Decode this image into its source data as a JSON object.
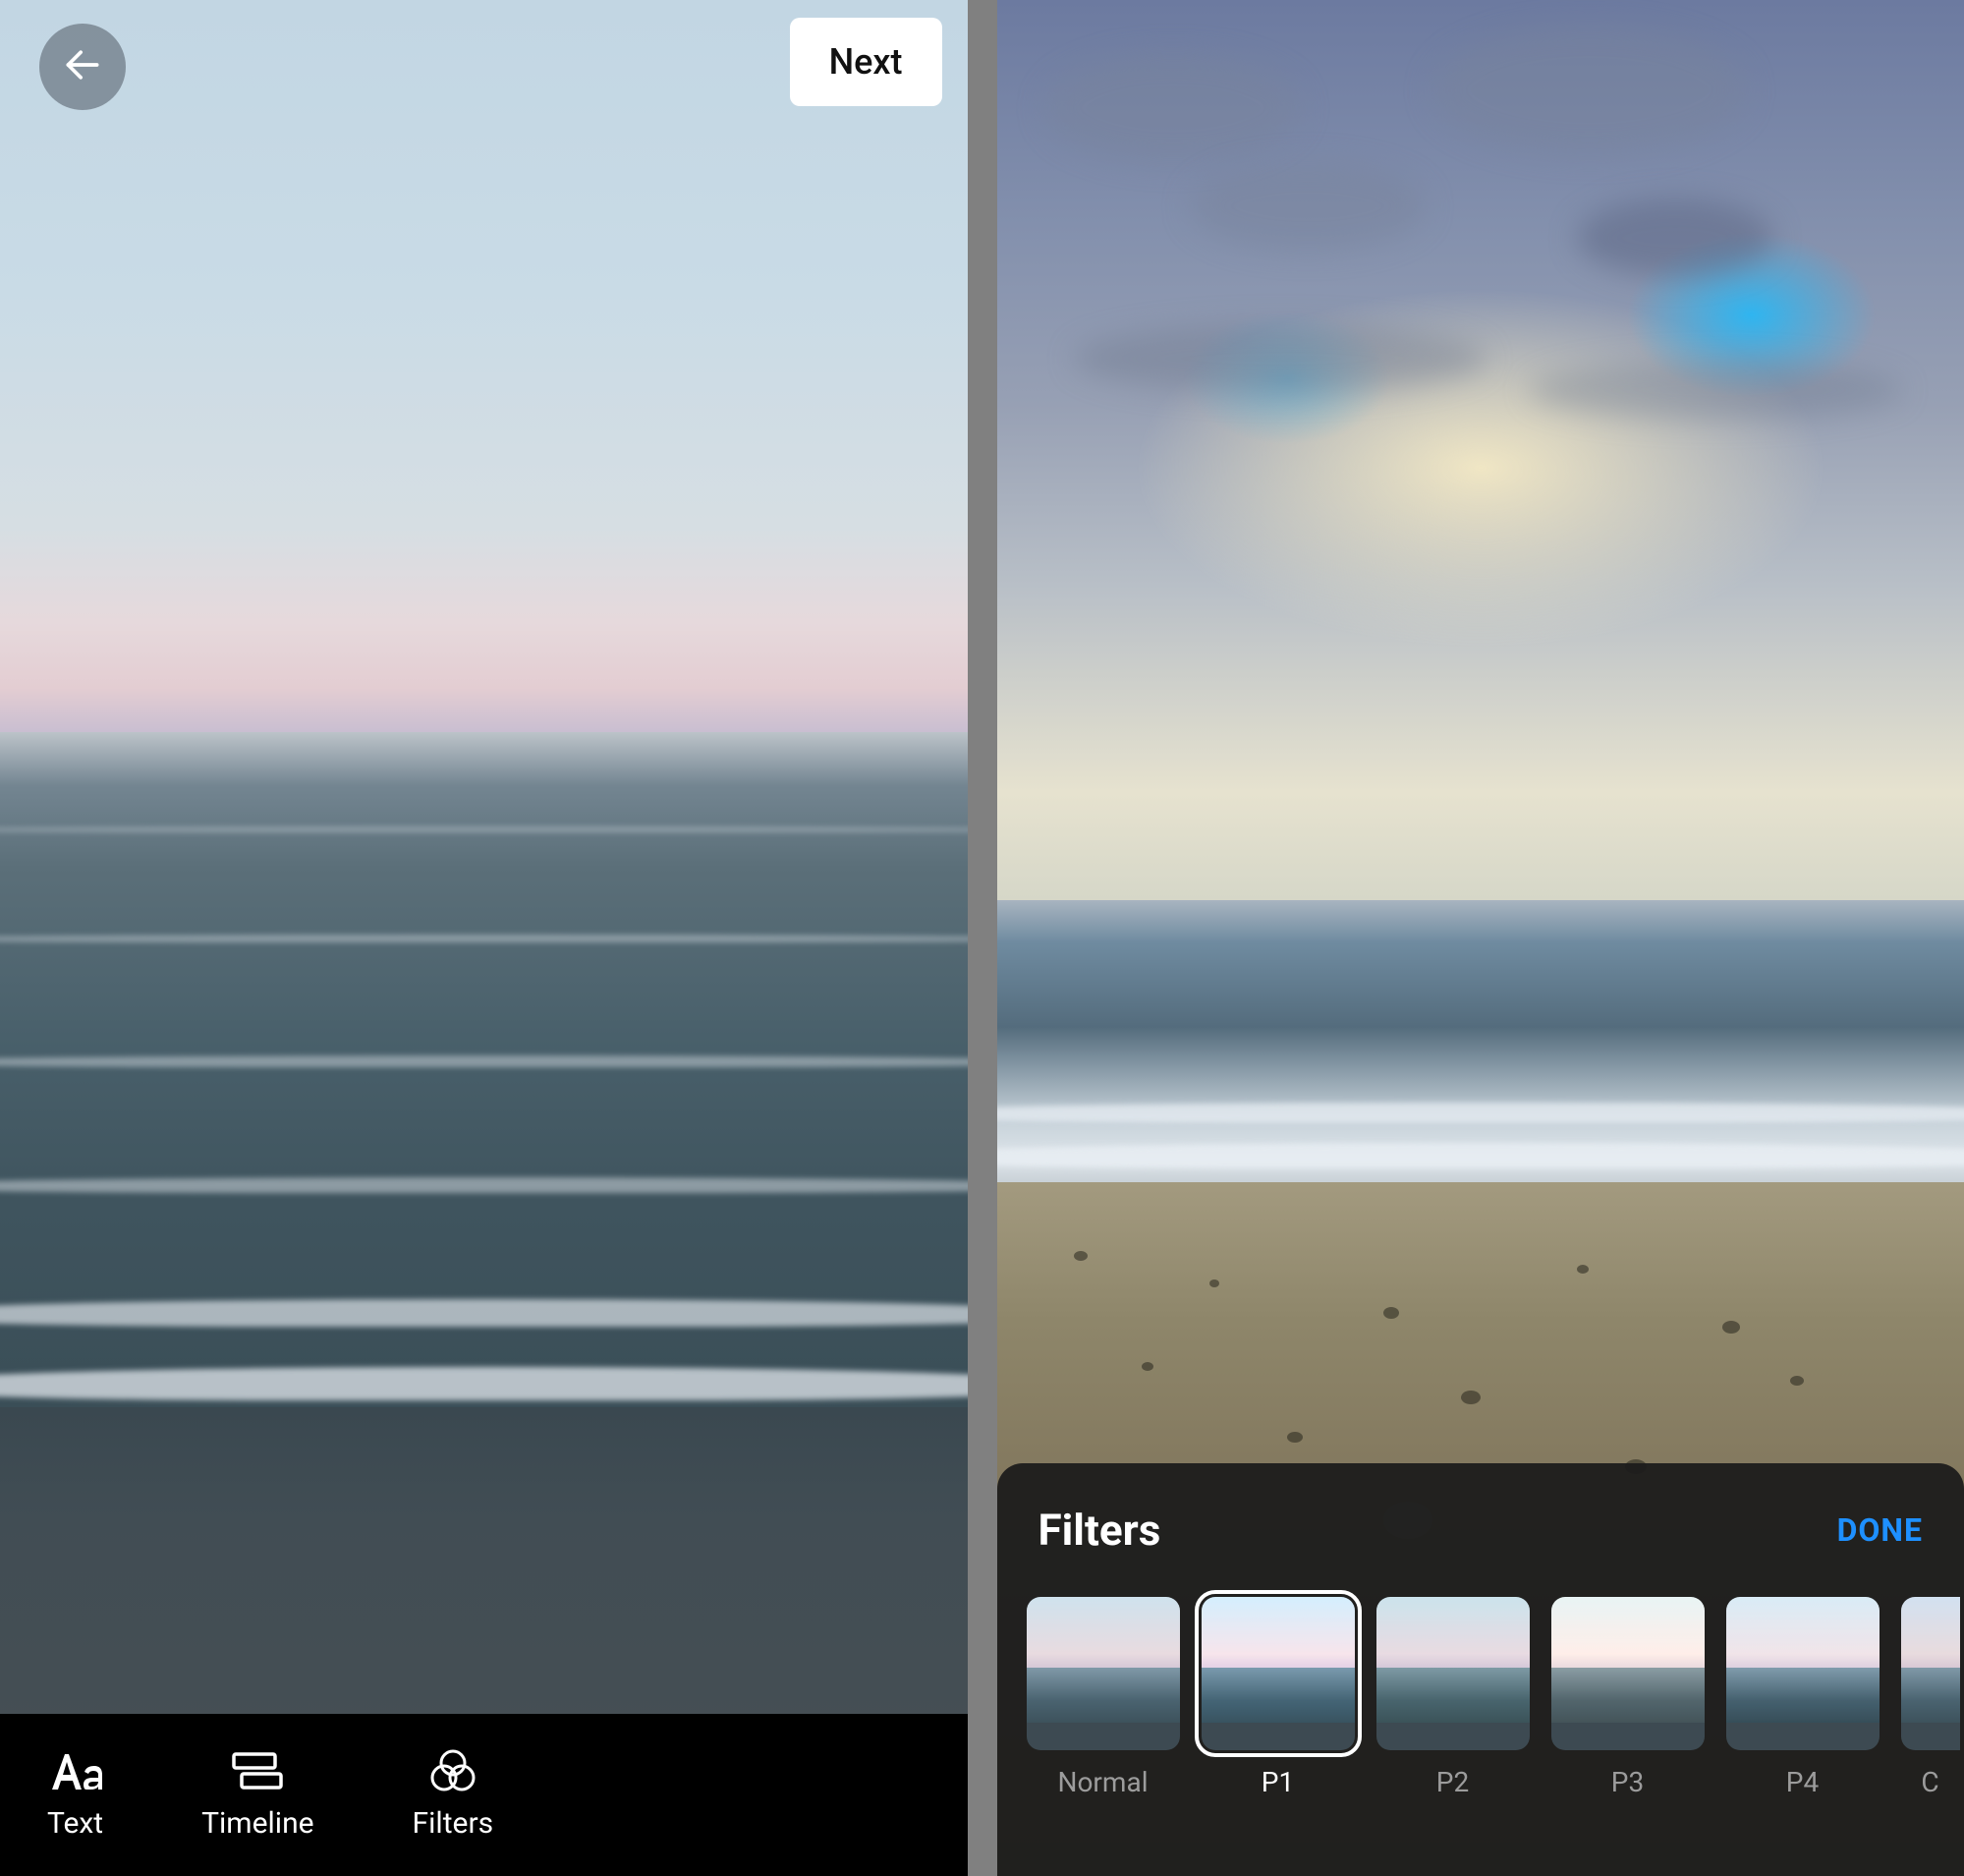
{
  "left": {
    "back_icon": "arrow-left",
    "next_label": "Next",
    "tools": [
      {
        "id": "text",
        "label": "Text",
        "icon": "text-aa-icon"
      },
      {
        "id": "timeline",
        "label": "Timeline",
        "icon": "timeline-icon"
      },
      {
        "id": "filters",
        "label": "Filters",
        "icon": "filters-venn-icon"
      }
    ]
  },
  "right": {
    "panel_title": "Filters",
    "done_label": "DONE",
    "selected_filter": "P1",
    "filters": [
      {
        "id": "normal",
        "label": "Normal"
      },
      {
        "id": "p1",
        "label": "P1"
      },
      {
        "id": "p2",
        "label": "P2"
      },
      {
        "id": "p3",
        "label": "P3"
      },
      {
        "id": "p4",
        "label": "P4"
      },
      {
        "id": "c",
        "label": "C"
      }
    ]
  },
  "colors": {
    "accent_blue": "#1e90ff"
  }
}
